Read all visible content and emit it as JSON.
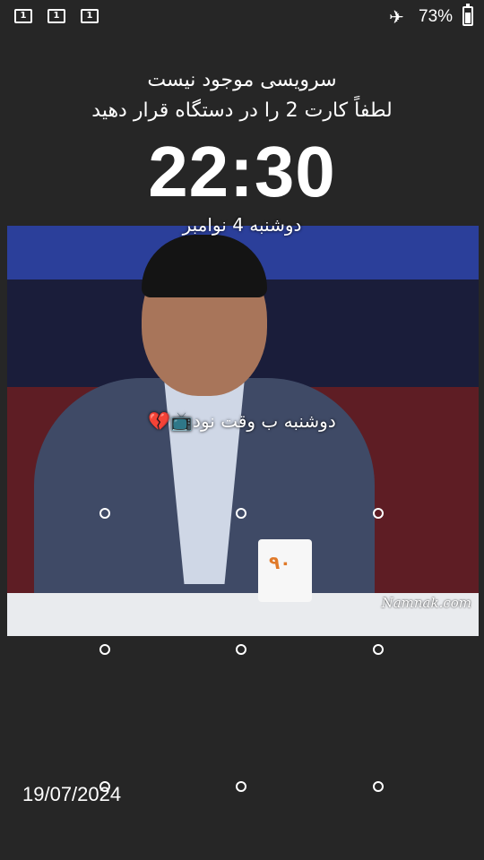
{
  "status_bar": {
    "sim_slots": [
      "1",
      "1",
      "1"
    ],
    "airplane_icon": "airplane-mode-icon",
    "battery_percent": "73%",
    "battery_level": 0.73
  },
  "lockscreen": {
    "service_message": "سرویسی موجود نیست",
    "insert_sim_message": "لطفاً کارت 2 را در دستگاه قرار دهید",
    "clock": "22:30",
    "date": "دوشنبه 4 نوامبر",
    "owner_info": "دوشنبه ب وقت نود📺💔"
  },
  "wallpaper": {
    "watermark": "Namnak.com",
    "mug_logo": "۹۰"
  },
  "pattern_dots": 9,
  "footer": {
    "date": "19/07/2024"
  }
}
